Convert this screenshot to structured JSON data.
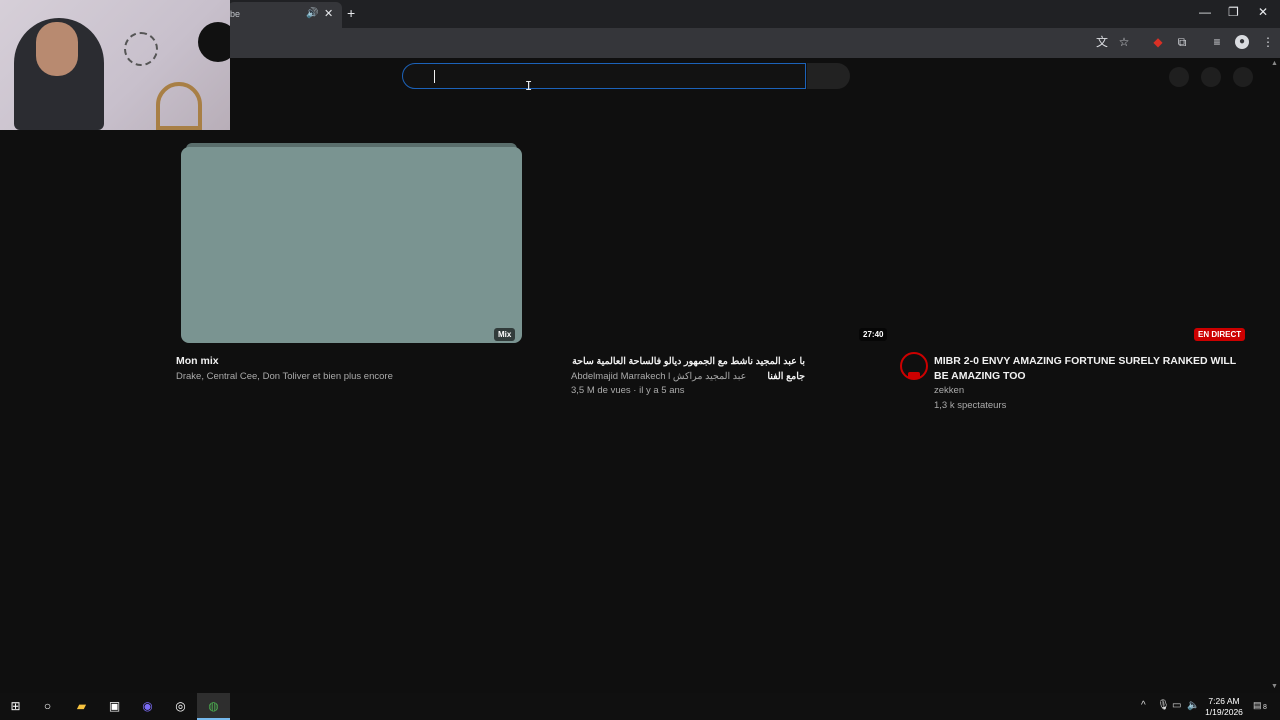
{
  "browser": {
    "tab_title": "be",
    "tab_audio_icon": "🔊",
    "tab_close_icon": "✕",
    "new_tab_icon": "+",
    "window_controls": [
      "—",
      "❐",
      "✕"
    ],
    "toolbar_icons": [
      "translate-icon",
      "star-icon",
      "extension-red-icon",
      "puzzle-icon",
      "reading-list-icon",
      "profile-icon",
      "kebab-menu-icon"
    ]
  },
  "youtube": {
    "search": {
      "placeholder": "",
      "value": ""
    },
    "videos": [
      {
        "title": "Mon mix",
        "channel": "Drake, Central Cee, Don Toliver et bien plus encore",
        "badge": "Mix",
        "thumbnail_color": "#7a9491"
      },
      {
        "title": "با عبد المجيد ناشط مع الجمهور ديالو فالساحة العالمية ساحة جامع الفنا",
        "channel": "Abdelmajid Marrakech l عبد المجيد مراكش",
        "stats": "3,5 M de vues · il y a 5 ans",
        "badge": "27:40"
      },
      {
        "title": "MIBR 2-0 ENVY AMAZING FORTUNE SURELY RANKED WILL BE AMAZING TOO",
        "channel": "zekken",
        "stats": "1,3 k spectateurs",
        "badge": "EN DIRECT"
      }
    ]
  },
  "taskbar": {
    "time": "7:26 AM",
    "date": "1/19/2026",
    "notification_count": "8"
  },
  "colors": {
    "page_bg": "#0f0f0f",
    "search_focus_border": "#1c62b9",
    "live_red": "#cc0000"
  }
}
